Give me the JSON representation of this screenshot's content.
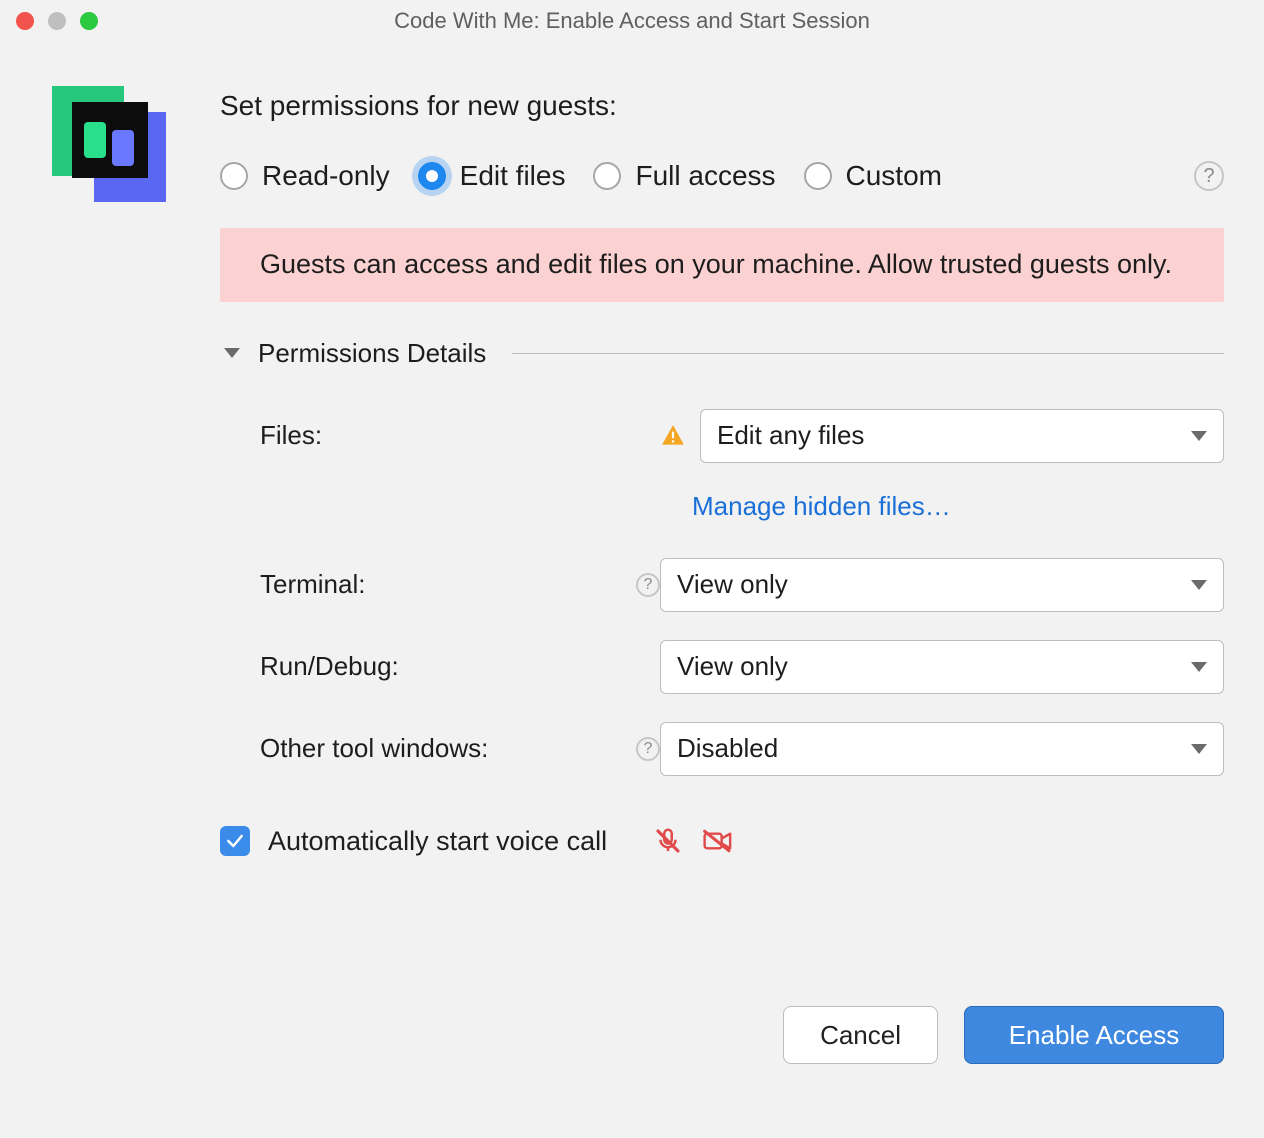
{
  "window": {
    "title": "Code With Me: Enable Access and Start Session"
  },
  "heading": "Set permissions for new guests:",
  "permission_modes": {
    "read_only": "Read-only",
    "edit_files": "Edit files",
    "full_access": "Full access",
    "custom": "Custom",
    "selected": "edit_files"
  },
  "warning_text": "Guests can access and edit files on your machine. Allow trusted guests only.",
  "details_section_label": "Permissions Details",
  "details": {
    "files": {
      "label": "Files:",
      "value": "Edit any files",
      "show_warning_icon": true,
      "manage_hidden_link": "Manage hidden files…"
    },
    "terminal": {
      "label": "Terminal:",
      "value": "View only"
    },
    "run_debug": {
      "label": "Run/Debug:",
      "value": "View only"
    },
    "other_tool_windows": {
      "label": "Other tool windows:",
      "value": "Disabled"
    }
  },
  "voice_call": {
    "checked": true,
    "label": "Automatically start voice call"
  },
  "buttons": {
    "cancel": "Cancel",
    "enable": "Enable Access"
  }
}
